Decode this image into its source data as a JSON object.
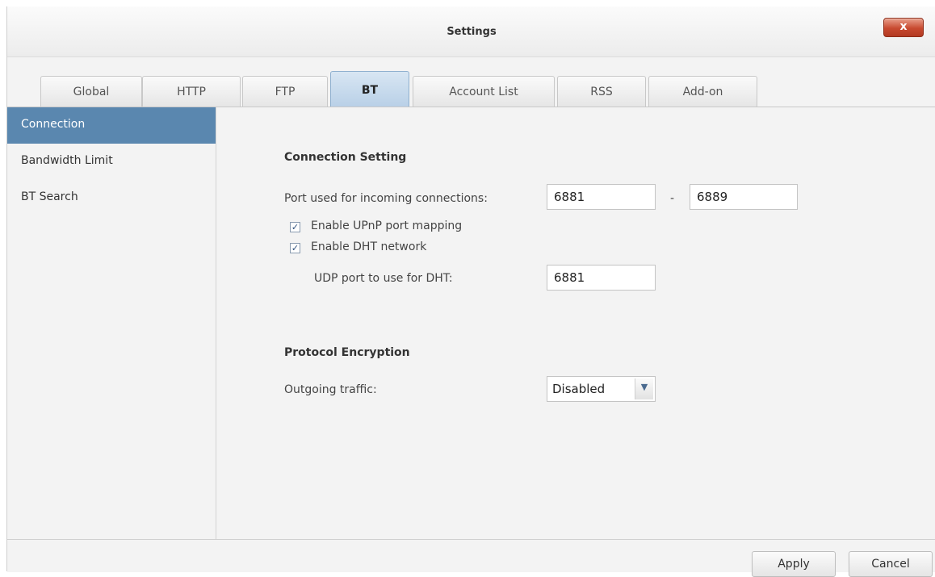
{
  "window": {
    "title": "Settings",
    "close_symbol": "x"
  },
  "tabs": [
    {
      "label": "Global"
    },
    {
      "label": "HTTP"
    },
    {
      "label": "FTP"
    },
    {
      "label": "BT"
    },
    {
      "label": "Account List"
    },
    {
      "label": "RSS"
    },
    {
      "label": "Add-on"
    }
  ],
  "active_tab": "BT",
  "sidebar": {
    "items": [
      {
        "label": "Connection"
      },
      {
        "label": "Bandwidth Limit"
      },
      {
        "label": "BT Search"
      }
    ],
    "active_item": "Connection"
  },
  "connection_setting": {
    "heading": "Connection Setting",
    "port_label": "Port used for incoming connections:",
    "port_from": "6881",
    "port_separator": "-",
    "port_to": "6889",
    "upnp_label": "Enable UPnP port mapping",
    "upnp_checked": true,
    "dht_label": "Enable DHT network",
    "dht_checked": true,
    "dht_udp_label": "UDP port to use for DHT:",
    "dht_udp_port": "6881"
  },
  "protocol_encryption": {
    "heading": "Protocol Encryption",
    "outgoing_label": "Outgoing traffic:",
    "outgoing_value": "Disabled"
  },
  "footer": {
    "apply_label": "Apply",
    "cancel_label": "Cancel"
  },
  "colors": {
    "accent": "#5a87af",
    "close_button": "#c84a30",
    "active_tab": "#b9d0e7"
  },
  "icons": {
    "check": "check-icon",
    "dropdown": "chevron-down-icon",
    "close": "close-icon"
  }
}
